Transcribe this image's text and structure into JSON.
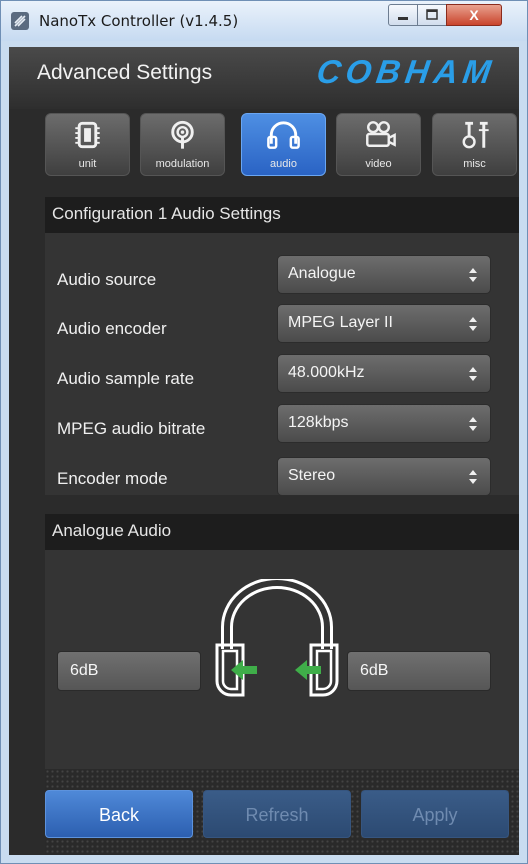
{
  "window": {
    "title": "NanoTx Controller (v1.4.5)",
    "close_glyph": "X"
  },
  "header": {
    "title": "Advanced Settings",
    "brand": "COBHAM"
  },
  "tabs": [
    {
      "label": "unit",
      "icon": "chip-icon",
      "active": false
    },
    {
      "label": "modulation",
      "icon": "antenna-icon",
      "active": false
    },
    {
      "label": "audio",
      "icon": "headphones-icon",
      "active": true
    },
    {
      "label": "video",
      "icon": "video-camera-icon",
      "active": false
    },
    {
      "label": "misc",
      "icon": "tools-icon",
      "active": false
    }
  ],
  "config_section": {
    "title": "Configuration 1 Audio Settings",
    "rows": [
      {
        "label": "Audio source",
        "value": "Analogue"
      },
      {
        "label": "Audio encoder",
        "value": "MPEG Layer II"
      },
      {
        "label": "Audio sample rate",
        "value": "48.000kHz"
      },
      {
        "label": "MPEG audio bitrate",
        "value": "128kbps"
      },
      {
        "label": "Encoder mode",
        "value": "Stereo"
      }
    ]
  },
  "analogue_section": {
    "title": "Analogue Audio",
    "left_level": "6dB",
    "right_level": "6dB"
  },
  "buttons": {
    "back": "Back",
    "refresh": "Refresh",
    "apply": "Apply"
  },
  "colors": {
    "accent": "#2a9ee8",
    "active_tab": "#3a78d6",
    "arrow_green": "#3fae49"
  }
}
